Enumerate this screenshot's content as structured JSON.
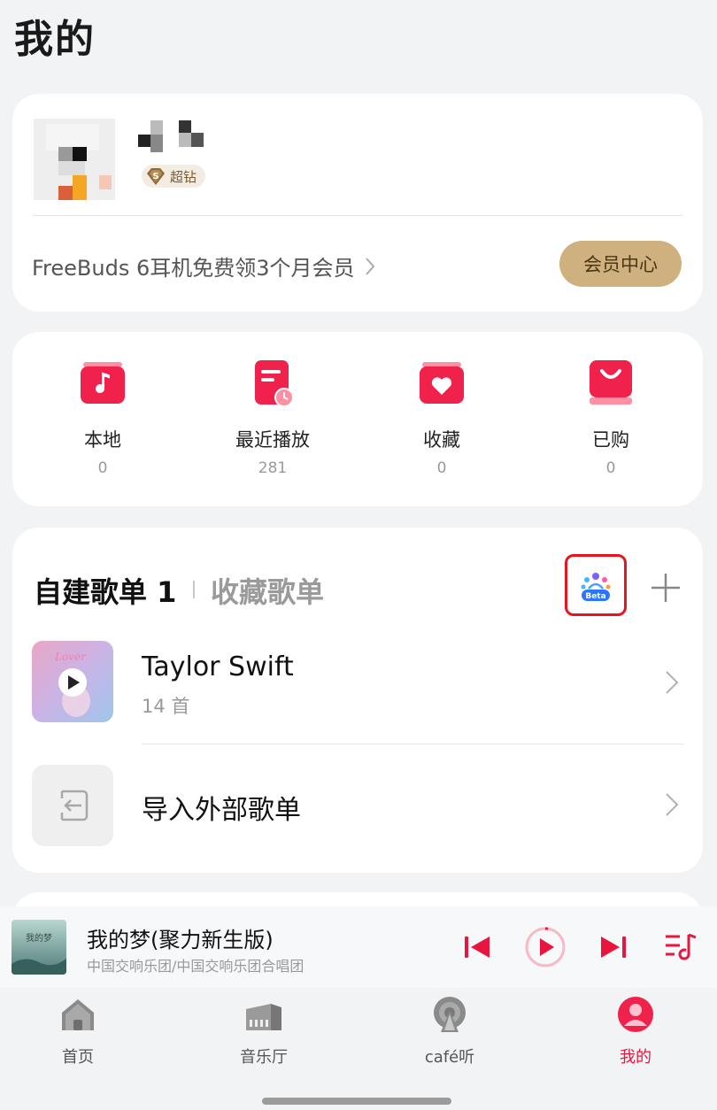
{
  "header": {
    "title": "我的"
  },
  "profile": {
    "vip_badge_text": "超钻",
    "promo_text": "FreeBuds 6耳机免费领3个月会员",
    "vip_center_label": "会员中心"
  },
  "shortcuts": [
    {
      "label": "本地",
      "count": "0",
      "icon": "music-note-icon"
    },
    {
      "label": "最近播放",
      "count": "281",
      "icon": "recent-play-icon"
    },
    {
      "label": "收藏",
      "count": "0",
      "icon": "heart-icon"
    },
    {
      "label": "已购",
      "count": "0",
      "icon": "shopping-bag-icon"
    }
  ],
  "playlists": {
    "tab_self_label": "自建歌单 1",
    "tab_fav_label": "收藏歌单",
    "beta_label": "Beta",
    "items": [
      {
        "name": "Taylor Swift",
        "count": "14 首",
        "cover_text": "Lover"
      }
    ],
    "import_label": "导入外部歌单"
  },
  "player": {
    "title": "我的梦(聚力新生版)",
    "artist": "中国交响乐团/中国交响乐团合唱团",
    "cover_text": "我的梦"
  },
  "nav": [
    {
      "label": "首页",
      "icon": "home-icon"
    },
    {
      "label": "音乐厅",
      "icon": "music-hall-icon"
    },
    {
      "label": "café听",
      "icon": "podcast-icon"
    },
    {
      "label": "我的",
      "icon": "profile-icon"
    }
  ],
  "colors": {
    "accent": "#e8163f",
    "vip_gold": "#cfb07f",
    "beta_highlight": "#e8151e"
  }
}
